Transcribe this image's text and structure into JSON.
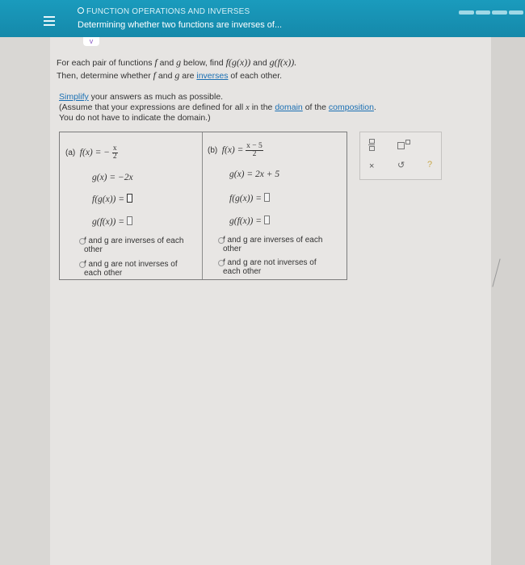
{
  "header": {
    "topic": "FUNCTION OPERATIONS AND INVERSES",
    "subtitle": "Determining whether two functions are inverses of..."
  },
  "chevron": "v",
  "instructions": {
    "line1_pre": "For each pair of functions ",
    "line1_mid": " and ",
    "line1_post": " below, find ",
    "line1_mid2": " and ",
    "f": "f",
    "g": "g",
    "fg": "f(g(x))",
    "gf": "g(f(x)).",
    "line2_pre": "Then, determine whether ",
    "line2_mid": " and ",
    "line2_post": " are ",
    "inverses_link": "inverses",
    "line2_end": " of each other."
  },
  "simplify": {
    "link": "Simplify",
    "text1": " your answers as much as possible.",
    "text2": "(Assume that your expressions are defined for all ",
    "x": "x",
    "text3": " in the ",
    "domain_link": "domain",
    "text4": " of the ",
    "composition_link": "composition",
    "text5": ".",
    "text6": "You do not have to indicate the domain.)"
  },
  "problem_a": {
    "label": "(a)",
    "f_lhs": "f(x) = −",
    "f_num": "x",
    "f_den": "2",
    "g_text": "g(x) = −2x",
    "fg_label": "f(g(x)) =",
    "gf_label": "g(f(x)) =",
    "option1_line1": "f and g are inverses of each",
    "option1_line2": "other",
    "option2_line1": "f and g are not inverses of",
    "option2_line2": "each other"
  },
  "problem_b": {
    "label": "(b)",
    "f_lhs": "f(x) =",
    "f_num": "x − 5",
    "f_den": "2",
    "g_text": "g(x) = 2x + 5",
    "fg_label": "f(g(x)) =",
    "gf_label": "g(f(x)) =",
    "option1_line1": "f and g are inverses of each",
    "option1_line2": "other",
    "option2_line1": "f and g are not inverses of",
    "option2_line2": "each other"
  },
  "tools": {
    "clear": "×",
    "undo": "↺",
    "help": "?"
  },
  "colors": {
    "header_bg": "#1589aa",
    "link": "#1a6fb3"
  }
}
